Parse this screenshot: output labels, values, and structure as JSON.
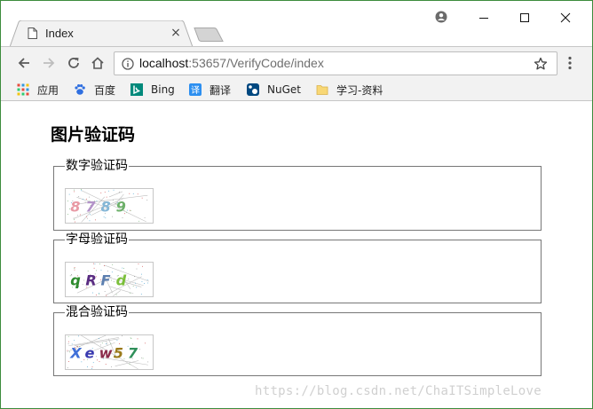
{
  "browser": {
    "tab_title": "Index",
    "tab_close": "×",
    "url_host": "localhost",
    "url_rest": ":53657/VerifyCode/index"
  },
  "bookmarks": [
    {
      "label": "应用",
      "icon": "apps-grid-icon"
    },
    {
      "label": "百度",
      "icon": "baidu-paw-icon"
    },
    {
      "label": "Bing",
      "icon": "bing-logo-icon"
    },
    {
      "label": "翻译",
      "icon": "translate-icon"
    },
    {
      "label": "NuGet",
      "icon": "nuget-icon"
    },
    {
      "label": "学习-资料",
      "icon": "folder-icon"
    }
  ],
  "page": {
    "title": "图片验证码",
    "groups": [
      {
        "legend": "数字验证码",
        "captcha_text": "8789",
        "chars": [
          "8",
          "7",
          "8",
          "9"
        ],
        "colors": [
          "#e89aa5",
          "#b393c9",
          "#84b6d6",
          "#6db06a"
        ]
      },
      {
        "legend": "字母验证码",
        "captcha_text": "qRFd",
        "chars": [
          "q",
          "R",
          "F",
          "d"
        ],
        "colors": [
          "#2e8b2e",
          "#5a2d82",
          "#5c7fb0",
          "#7bbf3a"
        ]
      },
      {
        "legend": "混合验证码",
        "captcha_text": "Xew57",
        "chars": [
          "X",
          "e",
          "w",
          "5",
          "7"
        ],
        "colors": [
          "#3f6fd8",
          "#3a3ab0",
          "#8a2a4a",
          "#9a7a1a",
          "#2f8f5a"
        ]
      }
    ]
  },
  "watermark": "https://blog.csdn.net/ChaITSimpleLove"
}
